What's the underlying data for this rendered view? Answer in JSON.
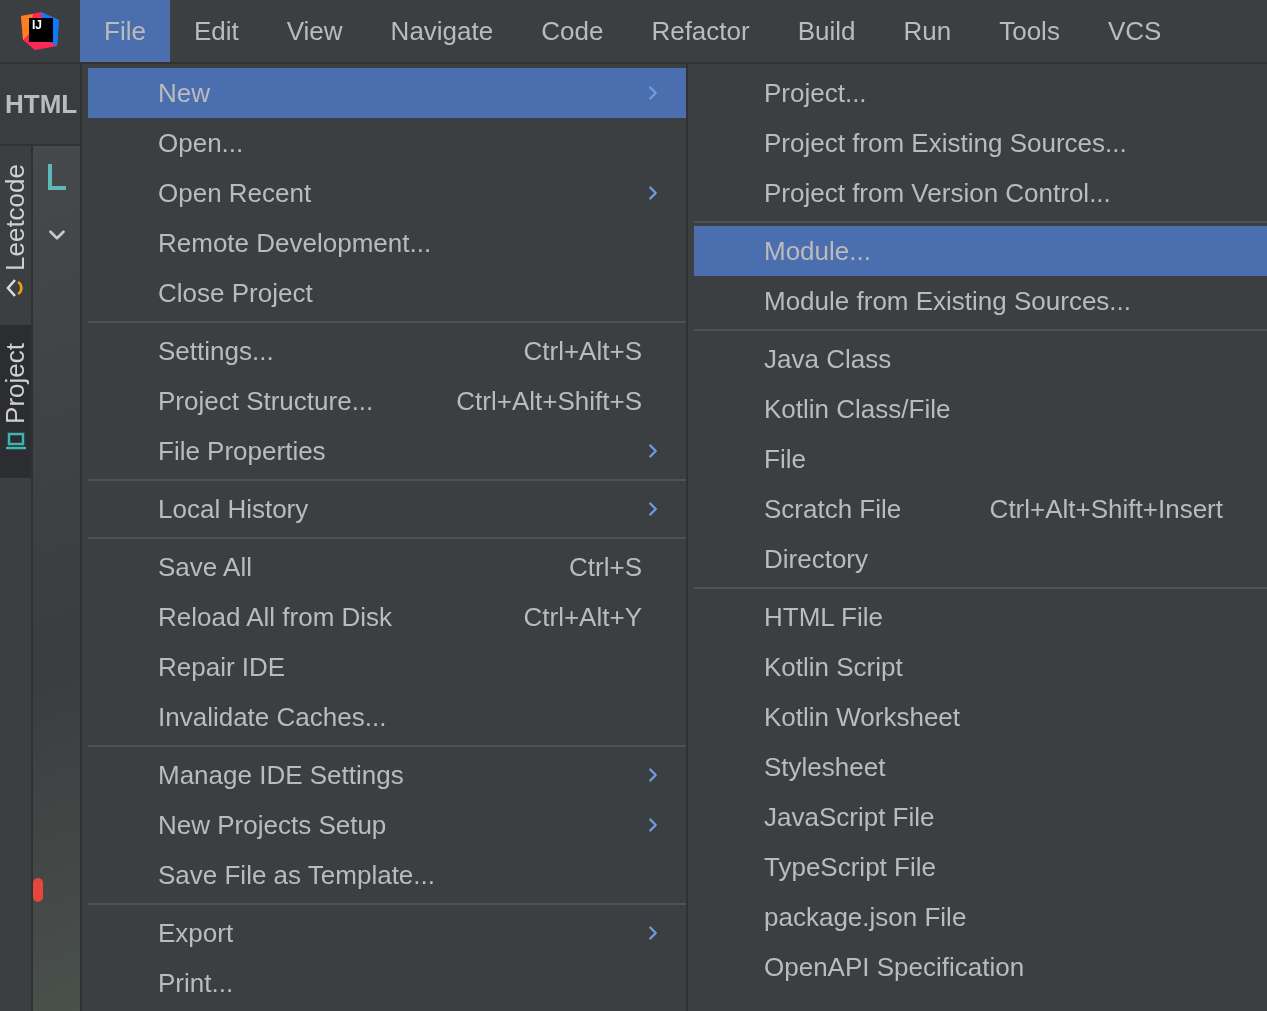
{
  "logo": {
    "text": "IJ"
  },
  "menubar": {
    "items": [
      {
        "label": "File",
        "selected": true
      },
      {
        "label": "Edit",
        "selected": false
      },
      {
        "label": "View",
        "selected": false
      },
      {
        "label": "Navigate",
        "selected": false
      },
      {
        "label": "Code",
        "selected": false
      },
      {
        "label": "Refactor",
        "selected": false
      },
      {
        "label": "Build",
        "selected": false
      },
      {
        "label": "Run",
        "selected": false
      },
      {
        "label": "Tools",
        "selected": false
      },
      {
        "label": "VCS",
        "selected": false
      }
    ]
  },
  "sidebar": {
    "header": "HTML",
    "tool_tabs": [
      {
        "label": "Leetcode",
        "selected": false
      },
      {
        "label": "Project",
        "selected": true
      }
    ]
  },
  "file_menu": {
    "groups": [
      {
        "items": [
          {
            "label": "New",
            "submenu": true,
            "selected": true
          },
          {
            "label": "Open...",
            "submenu": false,
            "selected": false
          },
          {
            "label": "Open Recent",
            "submenu": true,
            "selected": false
          },
          {
            "label": "Remote Development...",
            "submenu": false,
            "selected": false
          },
          {
            "label": "Close Project",
            "submenu": false,
            "selected": false
          }
        ]
      },
      {
        "items": [
          {
            "label": "Settings...",
            "shortcut": "Ctrl+Alt+S",
            "submenu": false,
            "selected": false
          },
          {
            "label": "Project Structure...",
            "shortcut": "Ctrl+Alt+Shift+S",
            "submenu": false,
            "selected": false
          },
          {
            "label": "File Properties",
            "submenu": true,
            "selected": false
          }
        ]
      },
      {
        "items": [
          {
            "label": "Local History",
            "submenu": true,
            "selected": false
          }
        ]
      },
      {
        "items": [
          {
            "label": "Save All",
            "shortcut": "Ctrl+S",
            "submenu": false,
            "selected": false
          },
          {
            "label": "Reload All from Disk",
            "shortcut": "Ctrl+Alt+Y",
            "submenu": false,
            "selected": false
          },
          {
            "label": "Repair IDE",
            "submenu": false,
            "selected": false
          },
          {
            "label": "Invalidate Caches...",
            "submenu": false,
            "selected": false
          }
        ]
      },
      {
        "items": [
          {
            "label": "Manage IDE Settings",
            "submenu": true,
            "selected": false
          },
          {
            "label": "New Projects Setup",
            "submenu": true,
            "selected": false
          },
          {
            "label": "Save File as Template...",
            "submenu": false,
            "selected": false
          }
        ]
      },
      {
        "items": [
          {
            "label": "Export",
            "submenu": true,
            "selected": false
          },
          {
            "label": "Print...",
            "submenu": false,
            "selected": false
          }
        ]
      }
    ]
  },
  "new_submenu": {
    "groups": [
      {
        "items": [
          {
            "label": "Project...",
            "selected": false
          },
          {
            "label": "Project from Existing Sources...",
            "selected": false
          },
          {
            "label": "Project from Version Control...",
            "selected": false
          }
        ]
      },
      {
        "items": [
          {
            "label": "Module...",
            "selected": true
          },
          {
            "label": "Module from Existing Sources...",
            "selected": false
          }
        ]
      },
      {
        "items": [
          {
            "label": "Java Class",
            "selected": false
          },
          {
            "label": "Kotlin Class/File",
            "selected": false
          },
          {
            "label": "File",
            "selected": false
          },
          {
            "label": "Scratch File",
            "shortcut": "Ctrl+Alt+Shift+Insert",
            "selected": false
          },
          {
            "label": "Directory",
            "selected": false
          }
        ]
      },
      {
        "items": [
          {
            "label": "HTML File",
            "selected": false
          },
          {
            "label": "Kotlin Script",
            "selected": false
          },
          {
            "label": "Kotlin Worksheet",
            "selected": false
          },
          {
            "label": "Stylesheet",
            "selected": false
          },
          {
            "label": "JavaScript File",
            "selected": false
          },
          {
            "label": "TypeScript File",
            "selected": false
          },
          {
            "label": "package.json File",
            "selected": false
          },
          {
            "label": "OpenAPI Specification",
            "selected": false
          }
        ]
      }
    ]
  }
}
